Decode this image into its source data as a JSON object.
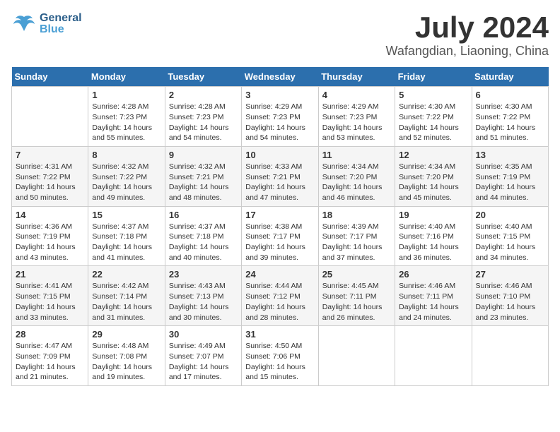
{
  "header": {
    "logo_general": "General",
    "logo_blue": "Blue",
    "month_year": "July 2024",
    "location": "Wafangdian, Liaoning, China"
  },
  "days_of_week": [
    "Sunday",
    "Monday",
    "Tuesday",
    "Wednesday",
    "Thursday",
    "Friday",
    "Saturday"
  ],
  "weeks": [
    [
      {
        "day": "",
        "info": ""
      },
      {
        "day": "1",
        "info": "Sunrise: 4:28 AM\nSunset: 7:23 PM\nDaylight: 14 hours\nand 55 minutes."
      },
      {
        "day": "2",
        "info": "Sunrise: 4:28 AM\nSunset: 7:23 PM\nDaylight: 14 hours\nand 54 minutes."
      },
      {
        "day": "3",
        "info": "Sunrise: 4:29 AM\nSunset: 7:23 PM\nDaylight: 14 hours\nand 54 minutes."
      },
      {
        "day": "4",
        "info": "Sunrise: 4:29 AM\nSunset: 7:23 PM\nDaylight: 14 hours\nand 53 minutes."
      },
      {
        "day": "5",
        "info": "Sunrise: 4:30 AM\nSunset: 7:22 PM\nDaylight: 14 hours\nand 52 minutes."
      },
      {
        "day": "6",
        "info": "Sunrise: 4:30 AM\nSunset: 7:22 PM\nDaylight: 14 hours\nand 51 minutes."
      }
    ],
    [
      {
        "day": "7",
        "info": "Sunrise: 4:31 AM\nSunset: 7:22 PM\nDaylight: 14 hours\nand 50 minutes."
      },
      {
        "day": "8",
        "info": "Sunrise: 4:32 AM\nSunset: 7:22 PM\nDaylight: 14 hours\nand 49 minutes."
      },
      {
        "day": "9",
        "info": "Sunrise: 4:32 AM\nSunset: 7:21 PM\nDaylight: 14 hours\nand 48 minutes."
      },
      {
        "day": "10",
        "info": "Sunrise: 4:33 AM\nSunset: 7:21 PM\nDaylight: 14 hours\nand 47 minutes."
      },
      {
        "day": "11",
        "info": "Sunrise: 4:34 AM\nSunset: 7:20 PM\nDaylight: 14 hours\nand 46 minutes."
      },
      {
        "day": "12",
        "info": "Sunrise: 4:34 AM\nSunset: 7:20 PM\nDaylight: 14 hours\nand 45 minutes."
      },
      {
        "day": "13",
        "info": "Sunrise: 4:35 AM\nSunset: 7:19 PM\nDaylight: 14 hours\nand 44 minutes."
      }
    ],
    [
      {
        "day": "14",
        "info": "Sunrise: 4:36 AM\nSunset: 7:19 PM\nDaylight: 14 hours\nand 43 minutes."
      },
      {
        "day": "15",
        "info": "Sunrise: 4:37 AM\nSunset: 7:18 PM\nDaylight: 14 hours\nand 41 minutes."
      },
      {
        "day": "16",
        "info": "Sunrise: 4:37 AM\nSunset: 7:18 PM\nDaylight: 14 hours\nand 40 minutes."
      },
      {
        "day": "17",
        "info": "Sunrise: 4:38 AM\nSunset: 7:17 PM\nDaylight: 14 hours\nand 39 minutes."
      },
      {
        "day": "18",
        "info": "Sunrise: 4:39 AM\nSunset: 7:17 PM\nDaylight: 14 hours\nand 37 minutes."
      },
      {
        "day": "19",
        "info": "Sunrise: 4:40 AM\nSunset: 7:16 PM\nDaylight: 14 hours\nand 36 minutes."
      },
      {
        "day": "20",
        "info": "Sunrise: 4:40 AM\nSunset: 7:15 PM\nDaylight: 14 hours\nand 34 minutes."
      }
    ],
    [
      {
        "day": "21",
        "info": "Sunrise: 4:41 AM\nSunset: 7:15 PM\nDaylight: 14 hours\nand 33 minutes."
      },
      {
        "day": "22",
        "info": "Sunrise: 4:42 AM\nSunset: 7:14 PM\nDaylight: 14 hours\nand 31 minutes."
      },
      {
        "day": "23",
        "info": "Sunrise: 4:43 AM\nSunset: 7:13 PM\nDaylight: 14 hours\nand 30 minutes."
      },
      {
        "day": "24",
        "info": "Sunrise: 4:44 AM\nSunset: 7:12 PM\nDaylight: 14 hours\nand 28 minutes."
      },
      {
        "day": "25",
        "info": "Sunrise: 4:45 AM\nSunset: 7:11 PM\nDaylight: 14 hours\nand 26 minutes."
      },
      {
        "day": "26",
        "info": "Sunrise: 4:46 AM\nSunset: 7:11 PM\nDaylight: 14 hours\nand 24 minutes."
      },
      {
        "day": "27",
        "info": "Sunrise: 4:46 AM\nSunset: 7:10 PM\nDaylight: 14 hours\nand 23 minutes."
      }
    ],
    [
      {
        "day": "28",
        "info": "Sunrise: 4:47 AM\nSunset: 7:09 PM\nDaylight: 14 hours\nand 21 minutes."
      },
      {
        "day": "29",
        "info": "Sunrise: 4:48 AM\nSunset: 7:08 PM\nDaylight: 14 hours\nand 19 minutes."
      },
      {
        "day": "30",
        "info": "Sunrise: 4:49 AM\nSunset: 7:07 PM\nDaylight: 14 hours\nand 17 minutes."
      },
      {
        "day": "31",
        "info": "Sunrise: 4:50 AM\nSunset: 7:06 PM\nDaylight: 14 hours\nand 15 minutes."
      },
      {
        "day": "",
        "info": ""
      },
      {
        "day": "",
        "info": ""
      },
      {
        "day": "",
        "info": ""
      }
    ]
  ]
}
